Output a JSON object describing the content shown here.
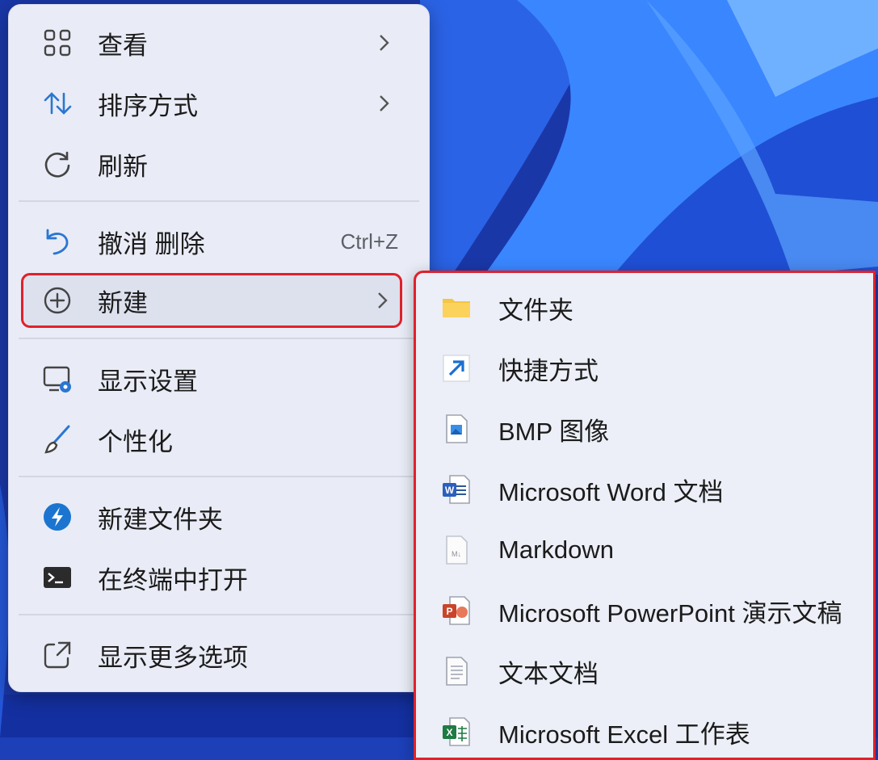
{
  "menu": {
    "items": [
      {
        "label": "查看",
        "icon": "grid-icon"
      },
      {
        "label": "排序方式",
        "icon": "sort-icon"
      },
      {
        "label": "刷新",
        "icon": "refresh-icon"
      },
      {
        "label": "撤消 删除",
        "icon": "undo-icon",
        "shortcut": "Ctrl+Z"
      },
      {
        "label": "新建",
        "icon": "add-circle-icon"
      },
      {
        "label": "显示设置",
        "icon": "display-settings-icon"
      },
      {
        "label": "个性化",
        "icon": "brush-icon"
      },
      {
        "label": "新建文件夹",
        "icon": "app-badge-icon"
      },
      {
        "label": "在终端中打开",
        "icon": "terminal-icon"
      },
      {
        "label": "显示更多选项",
        "icon": "open-external-icon"
      }
    ]
  },
  "submenu": {
    "items": [
      {
        "label": "文件夹",
        "icon": "folder-icon"
      },
      {
        "label": "快捷方式",
        "icon": "shortcut-icon"
      },
      {
        "label": "BMP 图像",
        "icon": "bmp-file-icon"
      },
      {
        "label": "Microsoft Word 文档",
        "icon": "word-icon"
      },
      {
        "label": "Markdown",
        "icon": "markdown-file-icon"
      },
      {
        "label": "Microsoft PowerPoint 演示文稿",
        "icon": "powerpoint-icon"
      },
      {
        "label": "文本文档",
        "icon": "text-file-icon"
      },
      {
        "label": "Microsoft Excel 工作表",
        "icon": "excel-icon"
      }
    ]
  },
  "colors": {
    "highlight_border": "#e0212b",
    "accent": "#2a76d2",
    "wallpaper": "#1d3fb8"
  }
}
